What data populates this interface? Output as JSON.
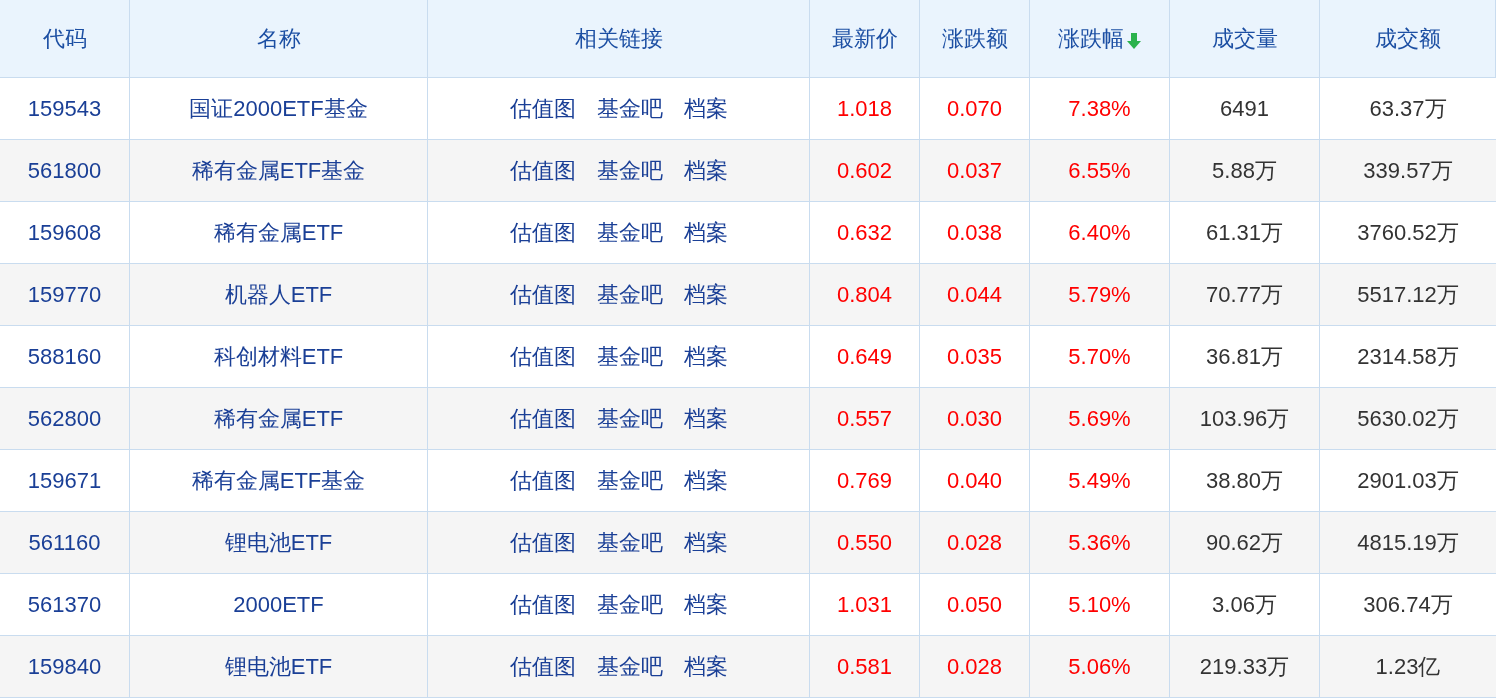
{
  "table": {
    "columns": [
      {
        "label": "代码",
        "sorted": false
      },
      {
        "label": "名称",
        "sorted": false
      },
      {
        "label": "相关链接",
        "sorted": false
      },
      {
        "label": "最新价",
        "sorted": false
      },
      {
        "label": "涨跌额",
        "sorted": false
      },
      {
        "label": "涨跌幅",
        "sorted": true
      },
      {
        "label": "成交量",
        "sorted": false
      },
      {
        "label": "成交额",
        "sorted": false
      }
    ],
    "rows": [
      {
        "code": "159543",
        "name": "国证2000ETF基金",
        "links": [
          "估值图",
          "基金吧",
          "档案"
        ],
        "price": "1.018",
        "change": "0.070",
        "pct": "7.38%",
        "volume": "6491",
        "amount": "63.37万",
        "rising": true
      },
      {
        "code": "561800",
        "name": "稀有金属ETF基金",
        "links": [
          "估值图",
          "基金吧",
          "档案"
        ],
        "price": "0.602",
        "change": "0.037",
        "pct": "6.55%",
        "volume": "5.88万",
        "amount": "339.57万",
        "rising": true
      },
      {
        "code": "159608",
        "name": "稀有金属ETF",
        "links": [
          "估值图",
          "基金吧",
          "档案"
        ],
        "price": "0.632",
        "change": "0.038",
        "pct": "6.40%",
        "volume": "61.31万",
        "amount": "3760.52万",
        "rising": true
      },
      {
        "code": "159770",
        "name": "机器人ETF",
        "links": [
          "估值图",
          "基金吧",
          "档案"
        ],
        "price": "0.804",
        "change": "0.044",
        "pct": "5.79%",
        "volume": "70.77万",
        "amount": "5517.12万",
        "rising": true
      },
      {
        "code": "588160",
        "name": "科创材料ETF",
        "links": [
          "估值图",
          "基金吧",
          "档案"
        ],
        "price": "0.649",
        "change": "0.035",
        "pct": "5.70%",
        "volume": "36.81万",
        "amount": "2314.58万",
        "rising": true
      },
      {
        "code": "562800",
        "name": "稀有金属ETF",
        "links": [
          "估值图",
          "基金吧",
          "档案"
        ],
        "price": "0.557",
        "change": "0.030",
        "pct": "5.69%",
        "volume": "103.96万",
        "amount": "5630.02万",
        "rising": true
      },
      {
        "code": "159671",
        "name": "稀有金属ETF基金",
        "links": [
          "估值图",
          "基金吧",
          "档案"
        ],
        "price": "0.769",
        "change": "0.040",
        "pct": "5.49%",
        "volume": "38.80万",
        "amount": "2901.03万",
        "rising": true
      },
      {
        "code": "561160",
        "name": "锂电池ETF",
        "links": [
          "估值图",
          "基金吧",
          "档案"
        ],
        "price": "0.550",
        "change": "0.028",
        "pct": "5.36%",
        "volume": "90.62万",
        "amount": "4815.19万",
        "rising": true
      },
      {
        "code": "561370",
        "name": "2000ETF",
        "links": [
          "估值图",
          "基金吧",
          "档案"
        ],
        "price": "1.031",
        "change": "0.050",
        "pct": "5.10%",
        "volume": "3.06万",
        "amount": "306.74万",
        "rising": true
      },
      {
        "code": "159840",
        "name": "锂电池ETF",
        "links": [
          "估值图",
          "基金吧",
          "档案"
        ],
        "price": "0.581",
        "change": "0.028",
        "pct": "5.06%",
        "volume": "219.33万",
        "amount": "1.23亿",
        "rising": true
      }
    ]
  }
}
